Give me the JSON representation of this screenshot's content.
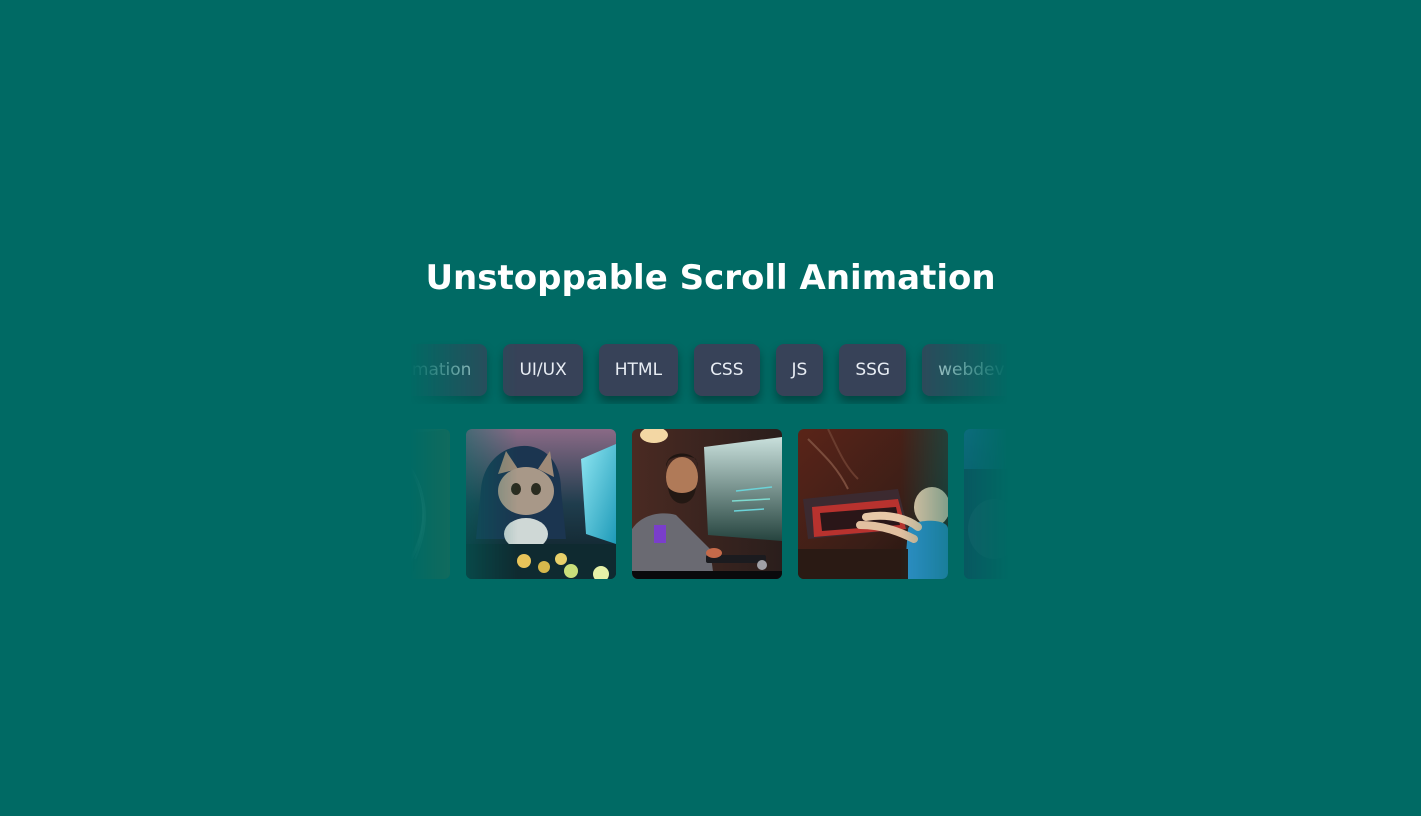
{
  "heading": "Unstoppable Scroll Animation",
  "tags": [
    "animation",
    "UI/UX",
    "HTML",
    "CSS",
    "JS",
    "SSG",
    "webdev"
  ],
  "images": [
    {
      "icon": "leaf-image"
    },
    {
      "icon": "cat-coding-image"
    },
    {
      "icon": "man-at-computer-image"
    },
    {
      "icon": "baby-typing-image"
    },
    {
      "icon": "blue-abstract-image"
    }
  ],
  "colors": {
    "background": "#006a64",
    "tag_bg": "#374258",
    "tag_text": "#e8edf4",
    "title": "#ffffff"
  }
}
